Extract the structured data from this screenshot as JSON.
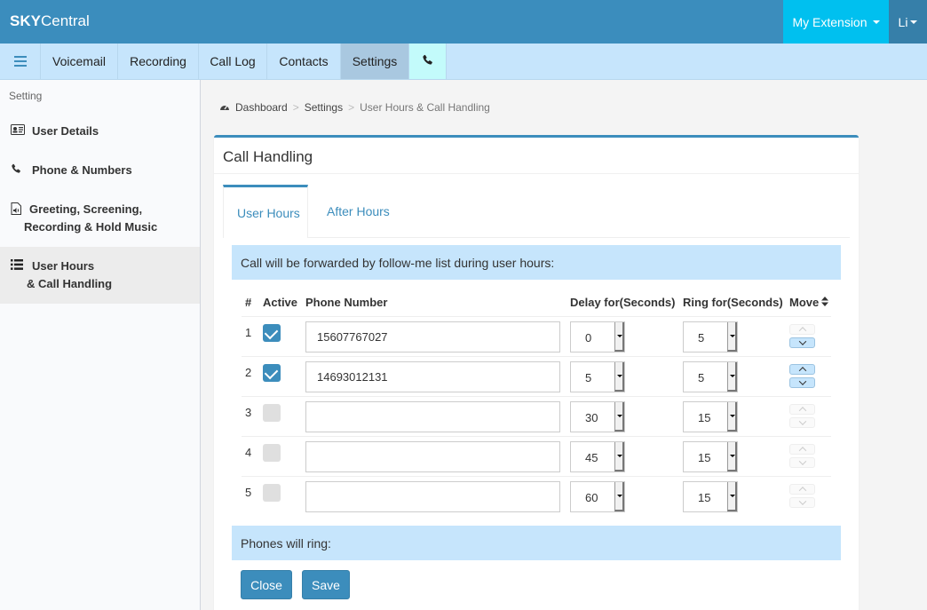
{
  "header": {
    "brand_bold": "SKY",
    "brand_rest": "Central",
    "extension_label": "My Extension",
    "user_label": "Li"
  },
  "nav": {
    "tabs": [
      {
        "label": "Voicemail"
      },
      {
        "label": "Recording"
      },
      {
        "label": "Call Log"
      },
      {
        "label": "Contacts"
      },
      {
        "label": "Settings",
        "active": true
      }
    ]
  },
  "sidebar": {
    "heading": "Setting",
    "items": [
      {
        "line1": "User Details",
        "icon": "id-card-icon"
      },
      {
        "line1": "Phone & Numbers",
        "icon": "phone-icon"
      },
      {
        "line1": "Greeting, Screening,",
        "line2": "Recording & Hold Music",
        "icon": "audio-file-icon"
      },
      {
        "line1": "User Hours",
        "line2": "& Call Handling",
        "icon": "list-icon",
        "active": true
      }
    ]
  },
  "breadcrumb": {
    "home": "Dashboard",
    "mid": "Settings",
    "current": "User Hours & Call Handling"
  },
  "panel": {
    "title": "Call Handling",
    "tabs": [
      "User Hours",
      "After Hours"
    ],
    "info_text": "Call will be forwarded by follow-me list during user hours:",
    "columns": {
      "num": "#",
      "active": "Active",
      "phone": "Phone Number",
      "delay": "Delay for(Seconds)",
      "ring": "Ring for(Seconds)",
      "move": "Move"
    },
    "rows": [
      {
        "num": "1",
        "active": true,
        "phone": "15607767027",
        "delay": "0",
        "ring": "5"
      },
      {
        "num": "2",
        "active": true,
        "phone": "14693012131",
        "delay": "5",
        "ring": "5"
      },
      {
        "num": "3",
        "active": false,
        "phone": "",
        "delay": "30",
        "ring": "15"
      },
      {
        "num": "4",
        "active": false,
        "phone": "",
        "delay": "45",
        "ring": "15"
      },
      {
        "num": "5",
        "active": false,
        "phone": "",
        "delay": "60",
        "ring": "15"
      }
    ],
    "ring_text": "Phones will ring:",
    "close_label": "Close",
    "save_label": "Save"
  }
}
